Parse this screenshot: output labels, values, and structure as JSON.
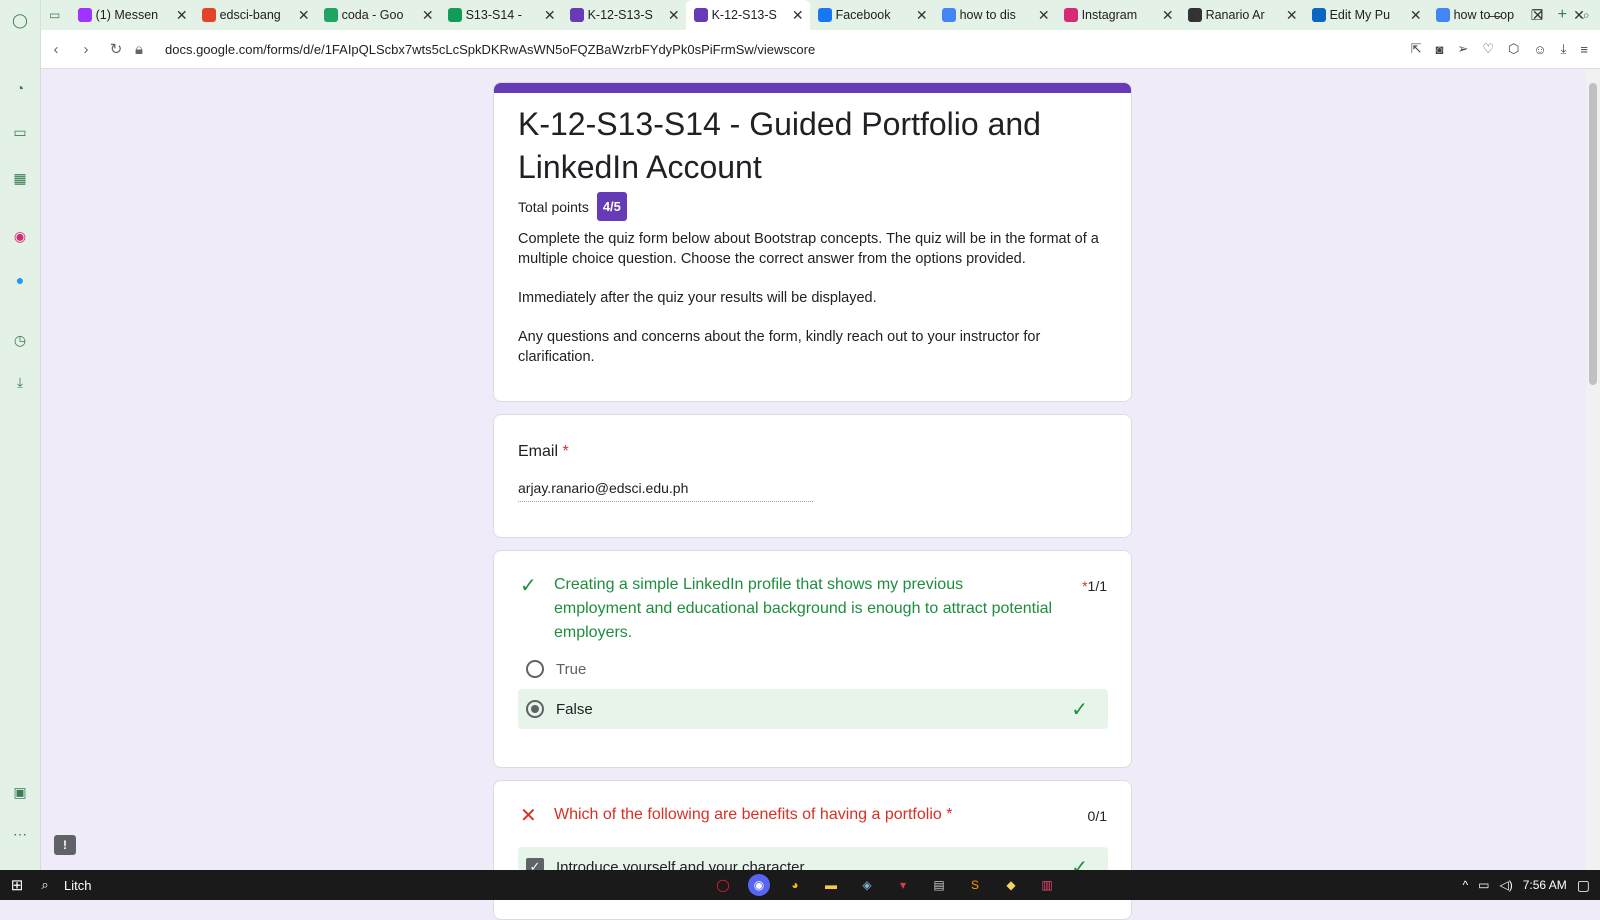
{
  "browser": {
    "tabs": [
      {
        "label": "(1) Messen",
        "icon": "messenger-icon",
        "color": "#a033ff"
      },
      {
        "label": "edsci-bang",
        "icon": "gitlab-icon",
        "color": "#e24329"
      },
      {
        "label": "coda - Goo",
        "icon": "google-drive-icon",
        "color": "#1fa463"
      },
      {
        "label": "S13-S14 - ",
        "icon": "google-classroom-icon",
        "color": "#0f9d58"
      },
      {
        "label": "K-12-S13-S",
        "icon": "google-forms-icon",
        "color": "#673ab7"
      },
      {
        "label": "K-12-S13-S",
        "icon": "google-forms-icon",
        "color": "#673ab7"
      },
      {
        "label": "Facebook",
        "icon": "facebook-icon",
        "color": "#1877f2"
      },
      {
        "label": "how to dis",
        "icon": "google-icon",
        "color": "#4285f4"
      },
      {
        "label": "Instagram",
        "icon": "instagram-icon",
        "color": "#d62976"
      },
      {
        "label": "Ranario Ar",
        "icon": "github-icon",
        "color": "#333333"
      },
      {
        "label": "Edit My Pu",
        "icon": "linkedin-icon",
        "color": "#0a66c2"
      },
      {
        "label": "how to cop",
        "icon": "google-icon",
        "color": "#4285f4"
      }
    ],
    "url": "docs.google.com/forms/d/e/1FAIpQLScbx7wts5cLcSpkDKRwAsWN5oFQZBaWzrbFYdyPk0sPiFrmSw/viewscore"
  },
  "form": {
    "title": "K-12-S13-S14 - Guided Portfolio and LinkedIn Account",
    "total_points_label": "Total points",
    "total_points": "4/5",
    "description": [
      "Complete the quiz form below about Bootstrap concepts. The quiz will be in the format of a multiple choice question. Choose the correct answer from the options provided.",
      "Immediately after the quiz your results will be displayed.",
      "Any questions and concerns about the form, kindly reach out to your instructor for clarification."
    ],
    "email": {
      "label": "Email",
      "required_mark": "*",
      "value": "arjay.ranario@edsci.edu.ph"
    },
    "q1": {
      "text": "Creating a simple LinkedIn profile that shows my previous employment and educational background is enough to attract potential employers.",
      "score": "1/1",
      "required_mark": "*",
      "options": [
        "True",
        "False"
      ],
      "selected": "False"
    },
    "q2": {
      "text": "Which of the following are benefits of having a portfolio",
      "required_mark": "*",
      "score": "0/1",
      "options": [
        "Introduce yourself and your character"
      ]
    }
  },
  "taskbar": {
    "search_text": "Litch",
    "time": "7:56 AM"
  },
  "colors": {
    "accent": "#673ab7",
    "correct": "#1e8e3e",
    "incorrect": "#d93025",
    "page_bg": "#f0ebf8",
    "sidebar_bg": "#e4f1e6"
  }
}
